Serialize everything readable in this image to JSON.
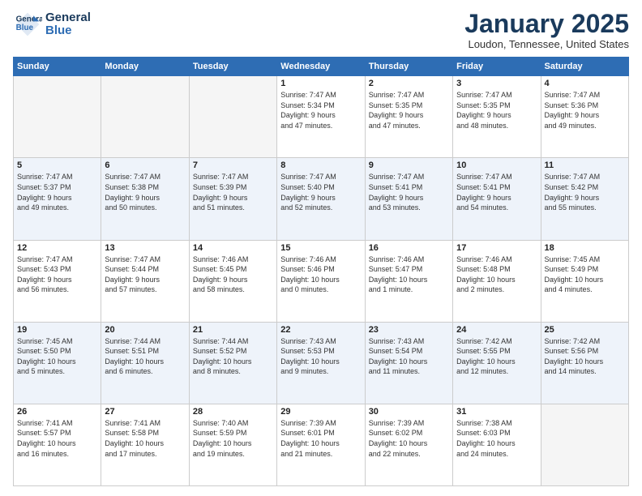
{
  "logo": {
    "line1": "General",
    "line2": "Blue"
  },
  "title": "January 2025",
  "location": "Loudon, Tennessee, United States",
  "days_of_week": [
    "Sunday",
    "Monday",
    "Tuesday",
    "Wednesday",
    "Thursday",
    "Friday",
    "Saturday"
  ],
  "weeks": [
    {
      "alt": false,
      "days": [
        {
          "num": "",
          "detail": ""
        },
        {
          "num": "",
          "detail": ""
        },
        {
          "num": "",
          "detail": ""
        },
        {
          "num": "1",
          "detail": "Sunrise: 7:47 AM\nSunset: 5:34 PM\nDaylight: 9 hours\nand 47 minutes."
        },
        {
          "num": "2",
          "detail": "Sunrise: 7:47 AM\nSunset: 5:35 PM\nDaylight: 9 hours\nand 47 minutes."
        },
        {
          "num": "3",
          "detail": "Sunrise: 7:47 AM\nSunset: 5:35 PM\nDaylight: 9 hours\nand 48 minutes."
        },
        {
          "num": "4",
          "detail": "Sunrise: 7:47 AM\nSunset: 5:36 PM\nDaylight: 9 hours\nand 49 minutes."
        }
      ]
    },
    {
      "alt": true,
      "days": [
        {
          "num": "5",
          "detail": "Sunrise: 7:47 AM\nSunset: 5:37 PM\nDaylight: 9 hours\nand 49 minutes."
        },
        {
          "num": "6",
          "detail": "Sunrise: 7:47 AM\nSunset: 5:38 PM\nDaylight: 9 hours\nand 50 minutes."
        },
        {
          "num": "7",
          "detail": "Sunrise: 7:47 AM\nSunset: 5:39 PM\nDaylight: 9 hours\nand 51 minutes."
        },
        {
          "num": "8",
          "detail": "Sunrise: 7:47 AM\nSunset: 5:40 PM\nDaylight: 9 hours\nand 52 minutes."
        },
        {
          "num": "9",
          "detail": "Sunrise: 7:47 AM\nSunset: 5:41 PM\nDaylight: 9 hours\nand 53 minutes."
        },
        {
          "num": "10",
          "detail": "Sunrise: 7:47 AM\nSunset: 5:41 PM\nDaylight: 9 hours\nand 54 minutes."
        },
        {
          "num": "11",
          "detail": "Sunrise: 7:47 AM\nSunset: 5:42 PM\nDaylight: 9 hours\nand 55 minutes."
        }
      ]
    },
    {
      "alt": false,
      "days": [
        {
          "num": "12",
          "detail": "Sunrise: 7:47 AM\nSunset: 5:43 PM\nDaylight: 9 hours\nand 56 minutes."
        },
        {
          "num": "13",
          "detail": "Sunrise: 7:47 AM\nSunset: 5:44 PM\nDaylight: 9 hours\nand 57 minutes."
        },
        {
          "num": "14",
          "detail": "Sunrise: 7:46 AM\nSunset: 5:45 PM\nDaylight: 9 hours\nand 58 minutes."
        },
        {
          "num": "15",
          "detail": "Sunrise: 7:46 AM\nSunset: 5:46 PM\nDaylight: 10 hours\nand 0 minutes."
        },
        {
          "num": "16",
          "detail": "Sunrise: 7:46 AM\nSunset: 5:47 PM\nDaylight: 10 hours\nand 1 minute."
        },
        {
          "num": "17",
          "detail": "Sunrise: 7:46 AM\nSunset: 5:48 PM\nDaylight: 10 hours\nand 2 minutes."
        },
        {
          "num": "18",
          "detail": "Sunrise: 7:45 AM\nSunset: 5:49 PM\nDaylight: 10 hours\nand 4 minutes."
        }
      ]
    },
    {
      "alt": true,
      "days": [
        {
          "num": "19",
          "detail": "Sunrise: 7:45 AM\nSunset: 5:50 PM\nDaylight: 10 hours\nand 5 minutes."
        },
        {
          "num": "20",
          "detail": "Sunrise: 7:44 AM\nSunset: 5:51 PM\nDaylight: 10 hours\nand 6 minutes."
        },
        {
          "num": "21",
          "detail": "Sunrise: 7:44 AM\nSunset: 5:52 PM\nDaylight: 10 hours\nand 8 minutes."
        },
        {
          "num": "22",
          "detail": "Sunrise: 7:43 AM\nSunset: 5:53 PM\nDaylight: 10 hours\nand 9 minutes."
        },
        {
          "num": "23",
          "detail": "Sunrise: 7:43 AM\nSunset: 5:54 PM\nDaylight: 10 hours\nand 11 minutes."
        },
        {
          "num": "24",
          "detail": "Sunrise: 7:42 AM\nSunset: 5:55 PM\nDaylight: 10 hours\nand 12 minutes."
        },
        {
          "num": "25",
          "detail": "Sunrise: 7:42 AM\nSunset: 5:56 PM\nDaylight: 10 hours\nand 14 minutes."
        }
      ]
    },
    {
      "alt": false,
      "days": [
        {
          "num": "26",
          "detail": "Sunrise: 7:41 AM\nSunset: 5:57 PM\nDaylight: 10 hours\nand 16 minutes."
        },
        {
          "num": "27",
          "detail": "Sunrise: 7:41 AM\nSunset: 5:58 PM\nDaylight: 10 hours\nand 17 minutes."
        },
        {
          "num": "28",
          "detail": "Sunrise: 7:40 AM\nSunset: 5:59 PM\nDaylight: 10 hours\nand 19 minutes."
        },
        {
          "num": "29",
          "detail": "Sunrise: 7:39 AM\nSunset: 6:01 PM\nDaylight: 10 hours\nand 21 minutes."
        },
        {
          "num": "30",
          "detail": "Sunrise: 7:39 AM\nSunset: 6:02 PM\nDaylight: 10 hours\nand 22 minutes."
        },
        {
          "num": "31",
          "detail": "Sunrise: 7:38 AM\nSunset: 6:03 PM\nDaylight: 10 hours\nand 24 minutes."
        },
        {
          "num": "",
          "detail": ""
        }
      ]
    }
  ]
}
